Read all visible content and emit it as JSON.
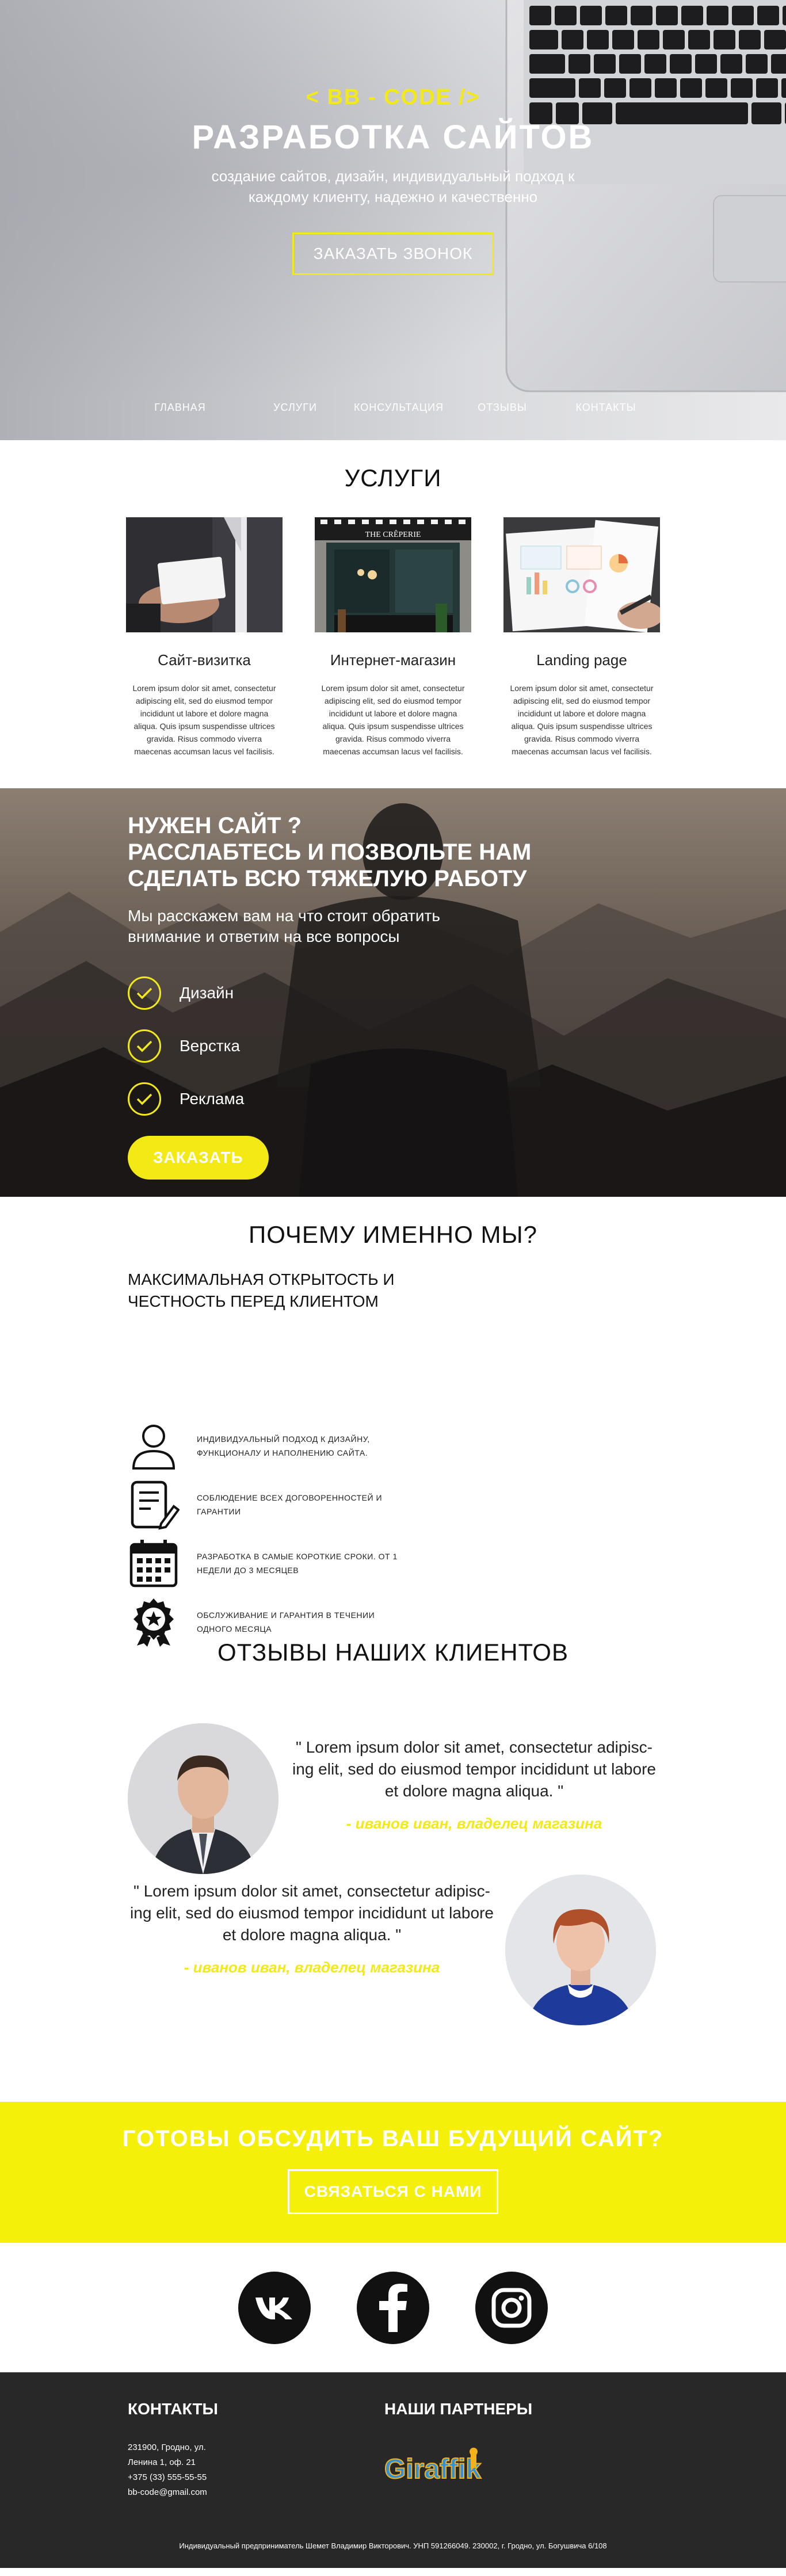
{
  "hero": {
    "brand": "< BB - CODE />",
    "title": "РАЗРАБОТКА САЙТОВ",
    "subtitle": "создание сайтов, дизайн, индивидуальный подход к каждому клиенту, надежно и качественно",
    "cta_label": "ЗАКАЗАТЬ ЗВОНОК",
    "nav": [
      "ГЛАВНАЯ",
      "УСЛУГИ",
      "КОНСУЛЬТАЦИЯ",
      "ОТЗЫВЫ",
      "КОНТАКТЫ"
    ]
  },
  "services": {
    "title": "УСЛУГИ",
    "cards": [
      {
        "title": "Сайт-визитка",
        "text": "Lorem ipsum dolor sit amet, consectetur adipiscing elit, sed do eiusmod tempor incididunt ut labore et dolore magna aliqua. Quis ipsum suspendisse ultrices gravida. Risus commodo viverra maecenas accumsan lacus vel facilisis.",
        "image_text": ""
      },
      {
        "title": "Интернет-магазин",
        "text": "Lorem ipsum dolor sit amet, consectetur adipiscing elit, sed do eiusmod tempor incididunt ut labore et dolore magna aliqua. Quis ipsum suspendisse ultrices gravida. Risus commodo viverra maecenas accumsan lacus vel facilisis.",
        "image_text": "THE CRÊPERIE"
      },
      {
        "title": "Landing page",
        "text": "Lorem ipsum dolor sit amet, consectetur adipiscing elit, sed do eiusmod tempor incididunt ut labore et dolore magna aliqua. Quis ipsum suspendisse ultrices gravida. Risus commodo viverra maecenas accumsan lacus vel facilisis.",
        "image_text": ""
      }
    ]
  },
  "banner": {
    "heading_lines": [
      "НУЖЕН САЙТ ?",
      "РАССЛАБТЕСЬ И ПОЗВОЛЬТЕ НАМ",
      "СДЕЛАТЬ ВСЮ ТЯЖЕЛУЮ РАБОТУ"
    ],
    "text": "Мы расскажем вам на что стоит обратить внимание и ответим на все вопросы",
    "checks": [
      "Дизайн",
      "Верстка",
      "Реклама"
    ],
    "order_label": "ЗАКАЗАТЬ"
  },
  "why": {
    "title": "ПОЧЕМУ ИМЕННО МЫ?",
    "subtitle": "МАКСИМАЛЬНАЯ ОТКРЫТОСТЬ И ЧЕСТНОСТЬ ПЕРЕД КЛИЕНТОМ",
    "items": [
      {
        "icon": "user-icon",
        "text": "ИНДИВИДУАЛЬНЫЙ ПОДХОД К ДИЗАЙНУ, ФУНКЦИОНАЛУ И НАПОЛНЕНИЮ САЙТА."
      },
      {
        "icon": "contract-icon",
        "text": "СОБЛЮДЕНИЕ ВСЕХ ДОГОВОРЕННОСТЕЙ И ГАРАНТИИ"
      },
      {
        "icon": "calendar-icon",
        "text": "РАЗРАБОТКА В САМЫЕ КОРОТКИЕ СРОКИ. ОТ 1 НЕДЕЛИ ДО 3 МЕСЯЦЕВ"
      },
      {
        "icon": "badge-icon",
        "text": "ОБСЛУЖИВАНИЕ И ГАРАНТИЯ В ТЕЧЕНИИ ОДНОГО МЕСЯЦА"
      }
    ]
  },
  "reviews": {
    "title": "ОТЗЫВЫ НАШИХ КЛИЕНТОВ",
    "items": [
      {
        "quote": "\" Lorem ipsum dolor sit amet, consectetur adipisc-ing elit, sed do eiusmod tempor incididunt ut labore et dolore magna aliqua. \"",
        "author": "- иванов иван, владелец магазина"
      },
      {
        "quote": "\" Lorem ipsum dolor sit amet, consectetur adipisc-ing elit, sed do eiusmod tempor incididunt ut labore et dolore magna aliqua. \"",
        "author": "- иванов иван, владелец магазина"
      }
    ]
  },
  "cta": {
    "title": "ГОТОВЫ ОБСУДИТЬ ВАШ БУДУЩИЙ САЙТ?",
    "button": "СВЯЗАТЬСЯ С НАМИ"
  },
  "social": {
    "items": [
      {
        "name": "vk-icon",
        "label": "VK"
      },
      {
        "name": "facebook-icon",
        "label": "f"
      },
      {
        "name": "instagram-icon",
        "label": ""
      }
    ]
  },
  "footer": {
    "contacts_title": "КОНТАКТЫ",
    "partners_title": "НАШИ ПАРТНЕРЫ",
    "partner_logo": "Giraffik",
    "address_line1": "231900, Гродно, ул.",
    "address_line2": "Ленина 1, оф. 21",
    "phone": "+375 (33) 555-55-55",
    "email": "bb-code@gmail.com",
    "legal": "Индивидуальный предприниматель Шемет Владимир Викторович. УНП 591266049. 230002, г. Гродно, ул. Богушвича 6/108"
  },
  "colors": {
    "accent": "#f3ea15",
    "footer_bg": "#282828",
    "cta_bg": "#f4f00a"
  }
}
